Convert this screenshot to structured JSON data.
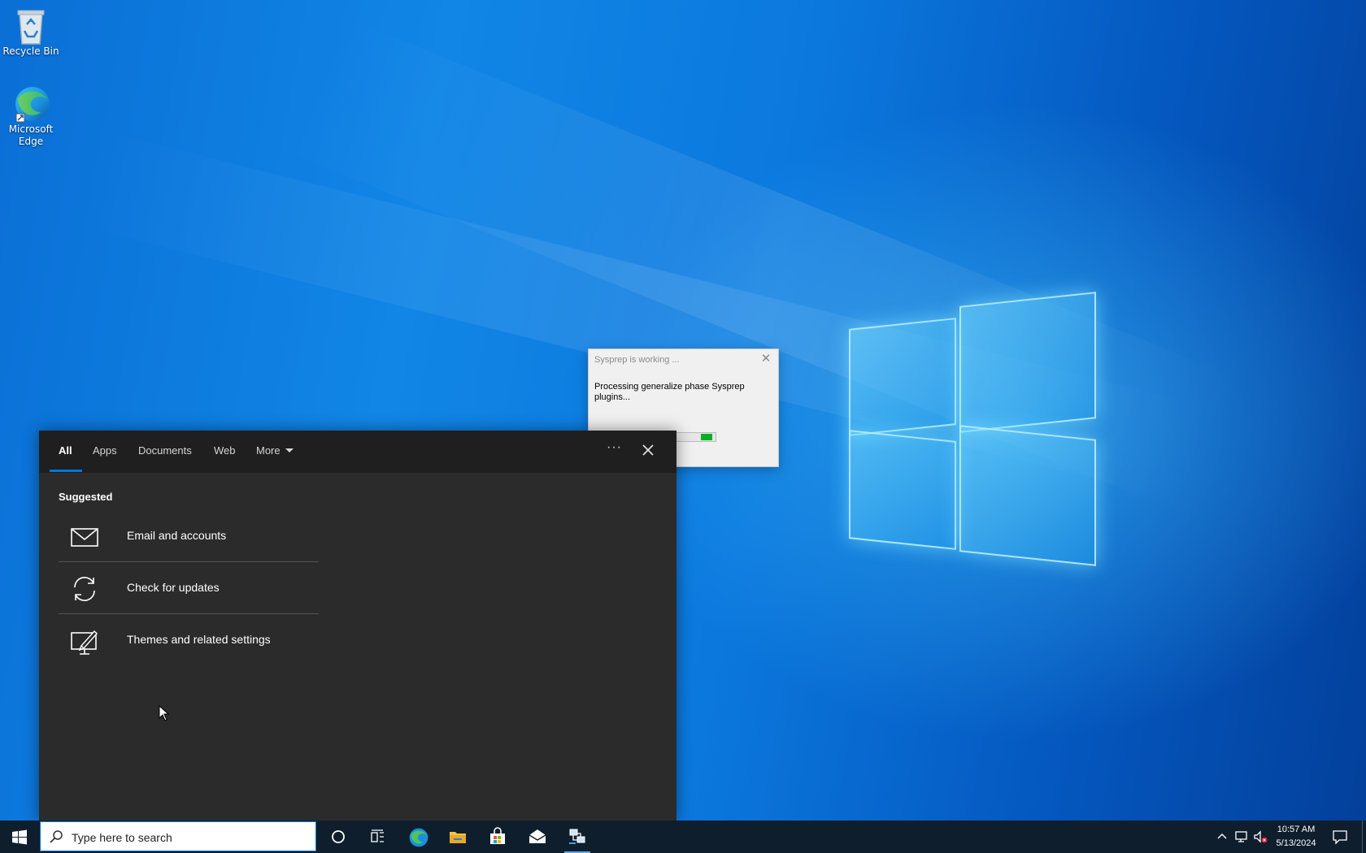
{
  "desktop": {
    "icons": [
      {
        "label": "Recycle Bin"
      },
      {
        "label": "Microsoft Edge"
      }
    ]
  },
  "sysprep_dialog": {
    "title": "Sysprep is working ...",
    "message": "Processing generalize phase Sysprep plugins...",
    "progress": "indeterminate"
  },
  "search_flyout": {
    "tabs": [
      {
        "label": "All",
        "active": true
      },
      {
        "label": "Apps"
      },
      {
        "label": "Documents"
      },
      {
        "label": "Web"
      },
      {
        "label": "More"
      }
    ],
    "options_icon": "more-options-icon",
    "close_icon": "close-icon",
    "section_label": "Suggested",
    "suggestions": [
      {
        "label": "Email and accounts",
        "icon": "mail-icon"
      },
      {
        "label": "Check for updates",
        "icon": "sync-icon"
      },
      {
        "label": "Themes and related settings",
        "icon": "themes-icon"
      }
    ]
  },
  "taskbar": {
    "search_placeholder": "Type here to search",
    "pinned": [
      "start-icon",
      "cortana-icon",
      "task-view-icon",
      "edge-icon",
      "file-explorer-icon",
      "store-icon",
      "mail-icon",
      "sysprep-icon"
    ],
    "clock": {
      "time": "10:57 AM",
      "date": "5/13/2024"
    },
    "accent": "#0078d7"
  }
}
